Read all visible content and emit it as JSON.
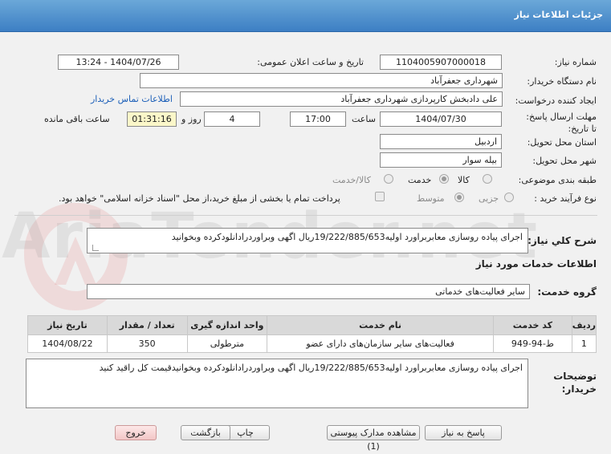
{
  "header": {
    "title": "جزئیات اطلاعات نیاز"
  },
  "fields": {
    "need_number": {
      "label": "شماره نیاز:",
      "value": "1104005907000018"
    },
    "announce_datetime": {
      "label": "تاریخ و ساعت اعلان عمومی:",
      "value": "1404/07/26 - 13:24"
    },
    "buyer_org": {
      "label": "نام دستگاه خریدار:",
      "value": "شهرداری جعفرآباد"
    },
    "requester": {
      "label": "ایجاد کننده درخواست:",
      "value": "علی دادبخش کارپردازی شهرداری جعفرآباد",
      "contact_link": "اطلاعات تماس خریدار"
    },
    "deadline": {
      "label": "مهلت ارسال پاسخ: تا تاریخ:",
      "date": "1404/07/30",
      "time_label": "ساعت",
      "time": "17:00",
      "days": "4",
      "days_label": "روز و",
      "remaining": "01:31:16",
      "remaining_label": "ساعت باقی مانده"
    },
    "province": {
      "label": "استان محل تحویل:",
      "value": "اردبیل"
    },
    "city": {
      "label": "شهر محل تحویل:",
      "value": "بیله سوار"
    },
    "category": {
      "label": "طبقه بندی موضوعی:",
      "options": [
        "کالا",
        "خدمت",
        "کالا/خدمت"
      ],
      "selected": "خدمت"
    },
    "purchase_type": {
      "label": "نوع فرآیند خرید :",
      "options": [
        "جزیی",
        "متوسط"
      ],
      "selected": "متوسط",
      "payment_note": "پرداخت تمام یا بخشی از مبلغ خرید،از محل \"اسناد خزانه اسلامی\" خواهد بود."
    }
  },
  "description": {
    "label": "شرح کلي نياز:",
    "value": "اجرای پیاده روسازی معابربراورد اولیه19/222/885/653ریال اگهی وبراوردرادانلودکرده وبخوانید"
  },
  "services_section": {
    "title": "اطلاعات خدمات مورد نیاز"
  },
  "service_group": {
    "label": "گروه خدمت:",
    "value": "سایر فعالیت‌های خدماتی"
  },
  "table": {
    "headers": [
      "ردیف",
      "کد خدمت",
      "نام خدمت",
      "واحد اندازه گیری",
      "تعداد / مقدار",
      "تاریخ نیاز"
    ],
    "rows": [
      [
        "1",
        "ط-94-949",
        "فعالیت‌های سایر سازمان‌های دارای عضو",
        "مترطولی",
        "350",
        "1404/08/22"
      ]
    ]
  },
  "buyer_notes": {
    "label": "توضیحات خریدار:",
    "value": "اجرای پیاده روسازی معابربراورد اولیه19/222/885/653ریال اگهی وبراوردرادانلودکرده وبخوانیدقیمت کل راقید کنید"
  },
  "buttons": {
    "reply": "پاسخ به نیاز",
    "attachments": "مشاهده مدارک پیوستی (1)",
    "print": "چاپ",
    "back": "بازگشت",
    "exit": "خروج"
  },
  "watermark": "AriaTender.net",
  "colors": {
    "header_blue": "#3d7fc4",
    "link_blue": "#1c5fb8",
    "yellow_field": "#fbf7c9",
    "exit_pink": "#f2c6c6"
  }
}
